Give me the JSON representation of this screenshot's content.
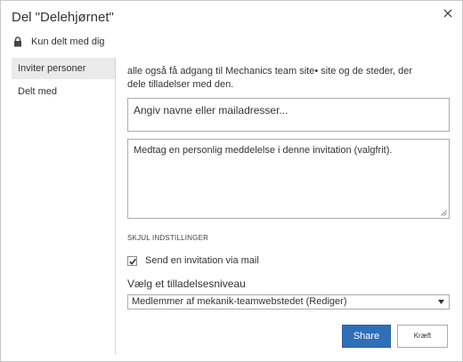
{
  "dialog": {
    "title": "Del \"Delehjørnet\"",
    "close_icon": "close-icon",
    "sharing_status": "Kun delt med dig",
    "status_icon": "lock-icon"
  },
  "nav": {
    "items": [
      {
        "label": "Inviter personer",
        "active": true
      },
      {
        "label": "Delt med",
        "active": false
      }
    ]
  },
  "invite": {
    "intro_line1": "alle også få adgang til Mechanics team site• site og de steder, der",
    "intro_line2": "dele tilladelser med den.",
    "people_placeholder": "Angiv navne eller mailadresser...",
    "message_placeholder": "Medtag en personlig meddelelse i denne invitation (valgfrit).",
    "options_toggle": "SKJUL INDSTILLINGER",
    "send_email_label": "Send en invitation via mail",
    "send_email_checked": true,
    "permission_label": "Vælg et tilladelsesniveau",
    "permission_selected": "Medlemmer af mekanik-teamwebstedet (Rediger)"
  },
  "buttons": {
    "share": "Share",
    "cancel": "Kræft"
  },
  "colors": {
    "accent": "#2f6fb7",
    "nav_active_bg": "#eaeaea",
    "border": "#ababab"
  }
}
